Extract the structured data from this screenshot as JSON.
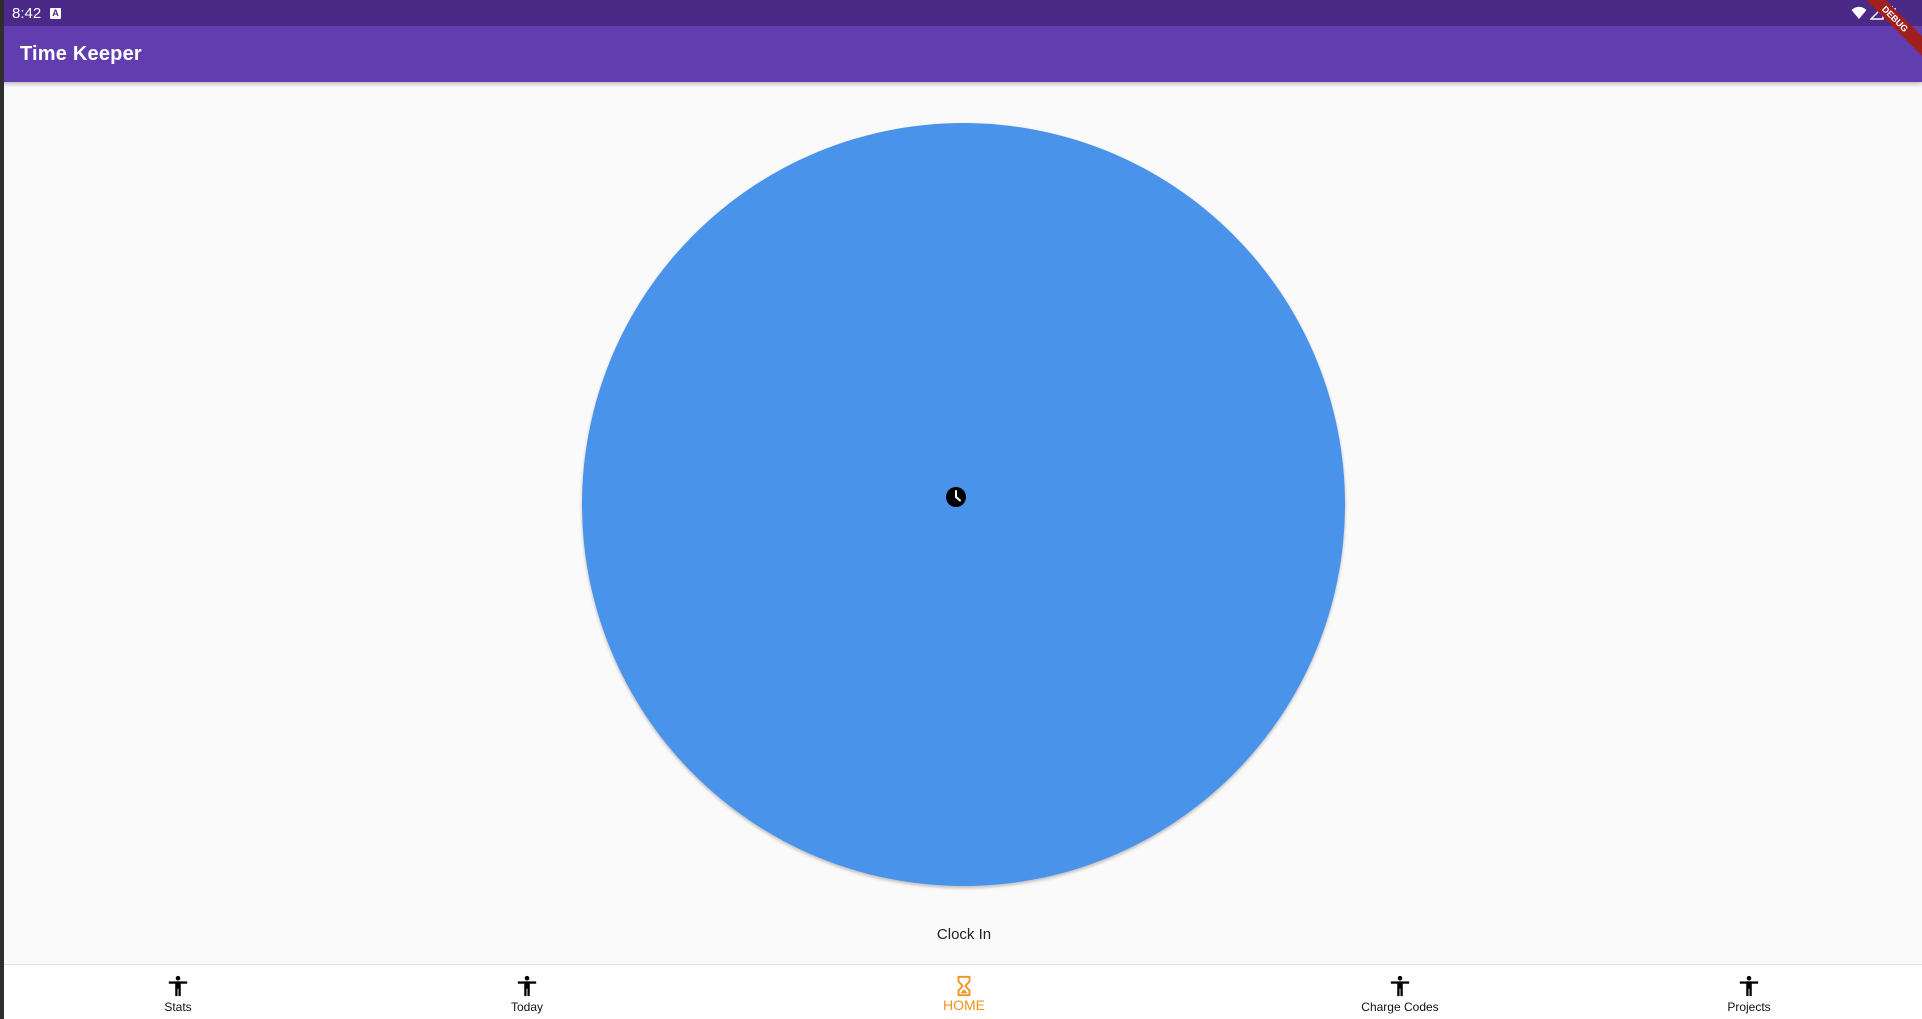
{
  "status_bar": {
    "time": "8:42",
    "notification_icon": "a-icon"
  },
  "app_bar": {
    "title": "Time Keeper",
    "debug_banner": "DEBUG"
  },
  "main": {
    "clock_button_icon": "clock-icon",
    "clock_label": "Clock In"
  },
  "bottom_nav": {
    "items": [
      {
        "label": "Stats",
        "icon": "accessibility-icon",
        "active": false
      },
      {
        "label": "Today",
        "icon": "accessibility-icon",
        "active": false
      },
      {
        "label": "HOME",
        "icon": "hourglass-icon",
        "active": true
      },
      {
        "label": "Charge Codes",
        "icon": "accessibility-icon",
        "active": false
      },
      {
        "label": "Projects",
        "icon": "accessibility-icon",
        "active": false
      }
    ]
  },
  "colors": {
    "status_bar": "#4a2a86",
    "app_bar": "#613db0",
    "clock_button": "#4a93ea",
    "active_nav": "#f0921e",
    "background": "#fafafa"
  }
}
